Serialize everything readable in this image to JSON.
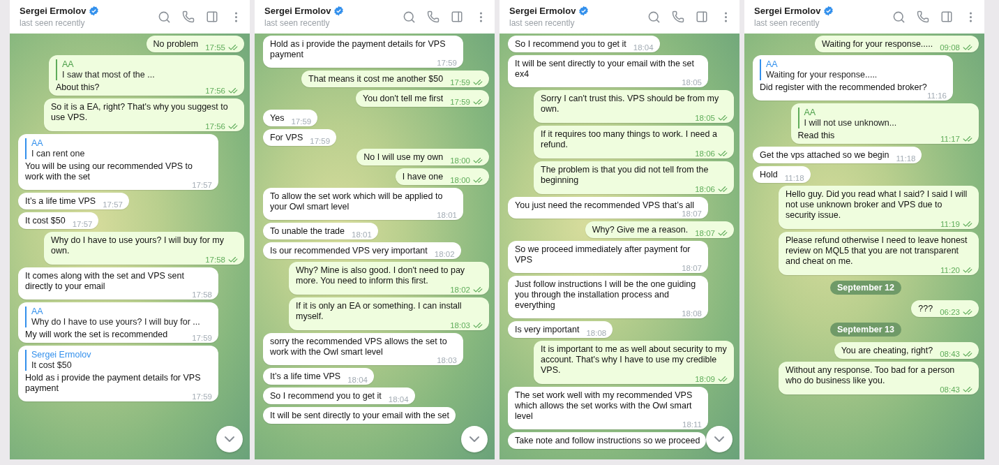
{
  "panels": [
    {
      "header": {
        "name": "Sergei Ermolov",
        "status": "last seen recently"
      },
      "scroll_button": true,
      "messages": [
        {
          "kind": "out",
          "text": "No problem",
          "time": "17:55",
          "read": true
        },
        {
          "kind": "out",
          "reply": {
            "author": "AA",
            "text": "I saw that most of the ..."
          },
          "text": "About this?",
          "time": "17:56",
          "read": true
        },
        {
          "kind": "out",
          "text": "So it is a EA, right? That's why you suggest to use VPS.",
          "time": "17:56",
          "read": true
        },
        {
          "kind": "in",
          "reply": {
            "author": "AA",
            "text": "I can rent one"
          },
          "text": "You will be using our recommended VPS to work with the set",
          "time": "17:57"
        },
        {
          "kind": "in",
          "text": "It’s a life time VPS",
          "time": "17:57"
        },
        {
          "kind": "in",
          "text": "It cost $50",
          "time": "17:57"
        },
        {
          "kind": "out",
          "text": "Why do I have to use yours? I will buy for my own.",
          "time": "17:58",
          "read": true
        },
        {
          "kind": "in",
          "text": "It comes along with the set and VPS sent directly to your email",
          "time": "17:58"
        },
        {
          "kind": "in",
          "reply": {
            "author": "AA",
            "text": "Why do I have to use yours? I will buy for ..."
          },
          "text": "My will work the set is recommended",
          "time": "17:59"
        },
        {
          "kind": "in",
          "reply": {
            "author": "Sergei Ermolov",
            "text": "It cost $50"
          },
          "text": "Hold as i provide the payment details for VPS payment",
          "time": "17:59"
        }
      ]
    },
    {
      "header": {
        "name": "Sergei Ermolov",
        "status": "last seen recently"
      },
      "scroll_button": true,
      "messages": [
        {
          "kind": "in",
          "text": "Hold as i provide the payment details for VPS payment",
          "time": "17:59"
        },
        {
          "kind": "out",
          "text": "That means it cost me another $50",
          "time": "17:59",
          "read": true
        },
        {
          "kind": "out",
          "text": "You don't tell me first",
          "time": "17:59",
          "read": true
        },
        {
          "kind": "in",
          "text": "Yes",
          "time": "17:59"
        },
        {
          "kind": "in",
          "text": "For VPS",
          "time": "17:59"
        },
        {
          "kind": "out",
          "text": "No I will use my own",
          "time": "18:00",
          "read": true
        },
        {
          "kind": "out",
          "text": "I have one",
          "time": "18:00",
          "read": true
        },
        {
          "kind": "in",
          "text": "To allow the set work which will be applied to your Owl smart level",
          "time": "18:01"
        },
        {
          "kind": "in",
          "text": "To unable the trade",
          "time": "18:01"
        },
        {
          "kind": "in",
          "text": "Is our recommended VPS very important",
          "time": "18:02"
        },
        {
          "kind": "out",
          "text": "Why? Mine is also good. I don't need to pay more. You need to inform this first.",
          "time": "18:02",
          "read": true
        },
        {
          "kind": "out",
          "text": "If it is only an EA or something. I can install myself.",
          "time": "18:03",
          "read": true
        },
        {
          "kind": "in",
          "text": "sorry the recommended VPS allows the set to work with the Owl smart level",
          "time": "18:03"
        },
        {
          "kind": "in",
          "text": "It’s a life time VPS",
          "time": "18:04"
        },
        {
          "kind": "in",
          "text": "So I recommend you to get it",
          "time": "18:04"
        },
        {
          "kind": "in",
          "text": "It will be sent directly to your email with the set"
        }
      ]
    },
    {
      "header": {
        "name": "Sergei Ermolov",
        "status": "last seen recently"
      },
      "scroll_button": true,
      "messages": [
        {
          "kind": "in",
          "text": "So I recommend you to get it",
          "time": "18:04"
        },
        {
          "kind": "in",
          "text": "It will be sent directly to your email with the set ex4",
          "time": "18:05"
        },
        {
          "kind": "out",
          "text": "Sorry I can't trust this. VPS should be from my own.",
          "time": "18:05",
          "read": true
        },
        {
          "kind": "out",
          "text": "If it requires too many things to work. I need a refund.",
          "time": "18:06",
          "read": true
        },
        {
          "kind": "out",
          "text": "The problem is that you did not tell from the beginning",
          "time": "18:06",
          "read": true
        },
        {
          "kind": "in",
          "text": "You just need the recommended VPS that’s all",
          "time": "18:07"
        },
        {
          "kind": "out",
          "text": "Why? Give me a reason.",
          "time": "18:07",
          "read": true
        },
        {
          "kind": "in",
          "text": "So we proceed immediately after payment for VPS",
          "time": "18:07"
        },
        {
          "kind": "in",
          "text": "Just follow instructions I will be the one guiding you through the installation process and everything",
          "time": "18:08"
        },
        {
          "kind": "in",
          "text": "Is very important",
          "time": "18:08"
        },
        {
          "kind": "out",
          "text": "It is important to me as well about security to my account. That's why I have to use my credible VPS.",
          "time": "18:09",
          "read": true
        },
        {
          "kind": "in",
          "text": "The set work well with my recommended VPS which allows the set works with the Owl smart level",
          "time": "18:11"
        },
        {
          "kind": "in",
          "text": "Take note and follow instructions so we proceed"
        }
      ]
    },
    {
      "header": {
        "name": "Sergei Ermolov",
        "status": "last seen recently"
      },
      "scroll_button": false,
      "messages": [
        {
          "kind": "out",
          "text": "Waiting for your response.....",
          "time": "09:08",
          "read": true
        },
        {
          "kind": "in",
          "reply": {
            "author": "AA",
            "text": "Waiting for your response....."
          },
          "text": "Did register with the recommended broker?",
          "time": "11:16"
        },
        {
          "kind": "out",
          "reply": {
            "author": "AA",
            "text": "I will not use unknown..."
          },
          "text": "Read this",
          "time": "11:17",
          "read": true
        },
        {
          "kind": "in",
          "text": "Get the vps attached so we begin",
          "time": "11:18"
        },
        {
          "kind": "in",
          "text": "Hold",
          "time": "11:18"
        },
        {
          "kind": "out",
          "text": "Hello guy. Did you read what I said? I said I will not use unknown broker and VPS due to security issue.",
          "time": "11:19",
          "read": true
        },
        {
          "kind": "out",
          "text": "Please refund otherwise I need to leave honest review on MQL5 that you are not transparent and cheat on me.",
          "time": "11:20",
          "read": true
        },
        {
          "kind": "date",
          "text": "September 12"
        },
        {
          "kind": "out",
          "text": "???",
          "time": "06:23",
          "read": true
        },
        {
          "kind": "date",
          "text": "September 13"
        },
        {
          "kind": "out",
          "text": "You are cheating, right?",
          "time": "08:43",
          "read": true
        },
        {
          "kind": "out",
          "text": "Without any response. Too bad for a person who do business like you.",
          "time": "08:43",
          "read": true
        }
      ]
    }
  ]
}
